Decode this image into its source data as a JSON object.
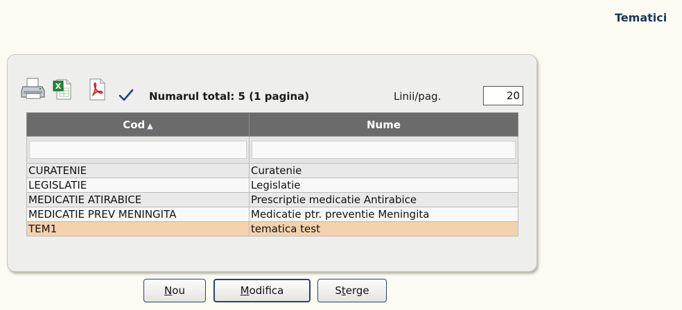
{
  "page": {
    "title": "Tematici"
  },
  "toolbar": {
    "icons": [
      "printer-icon",
      "excel-icon",
      "pdf-icon",
      "check-icon"
    ],
    "total_label": "Numarul total: 5 (1 pagina)",
    "rows_per_page_label": "Linii/pag.",
    "rows_per_page_value": "20"
  },
  "table": {
    "columns": [
      {
        "label": "Cod",
        "sorted": "ascending"
      },
      {
        "label": "Nume"
      }
    ],
    "rows": [
      {
        "cod": "CURATENIE",
        "nume": "Curatenie"
      },
      {
        "cod": "LEGISLATIE",
        "nume": "Legislatie"
      },
      {
        "cod": "MEDICATIE ATIRABICE",
        "nume": "Prescriptie medicatie Antirabice"
      },
      {
        "cod": "MEDICATIE PREV MENINGITA",
        "nume": "Medicatie ptr. preventie Meningita"
      },
      {
        "cod": "TEM1",
        "nume": "tematica test",
        "selected": true
      }
    ]
  },
  "buttons": {
    "new": {
      "mnemonic": "N",
      "rest": "ou"
    },
    "edit": {
      "mnemonic": "M",
      "rest": "odifica"
    },
    "delete": {
      "pre": "S",
      "mnemonic": "t",
      "rest": "erge"
    }
  },
  "colors": {
    "header_bg": "#6b6b6b",
    "selected_row": "#f3d2ad",
    "title": "#17365d"
  }
}
